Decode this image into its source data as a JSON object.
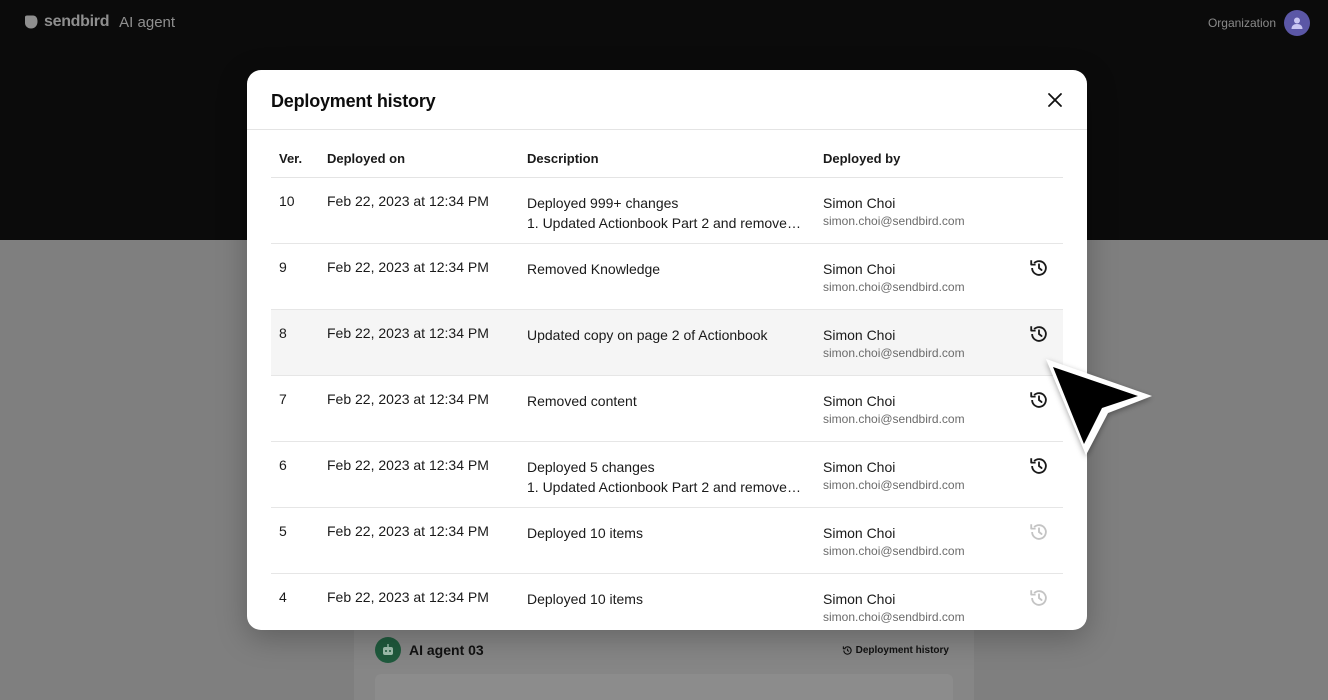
{
  "app": {
    "brand_name": "sendbird",
    "brand_product": "AI agent",
    "org_label": "Organization"
  },
  "background": {
    "agent_name": "AI agent 03",
    "deployment_history_link": "Deployment history"
  },
  "modal": {
    "title": "Deployment history",
    "columns": {
      "ver": "Ver.",
      "deployed_on": "Deployed on",
      "description": "Description",
      "deployed_by": "Deployed by"
    },
    "rows": [
      {
        "ver": "10",
        "date": "Feb 22, 2023 at 12:34 PM",
        "desc1": "Deployed 999+ changes",
        "desc2": "1. Updated Actionbook Part 2 and removed content",
        "name": "Simon Choi",
        "email": "simon.choi@sendbird.com",
        "restore": "none"
      },
      {
        "ver": "9",
        "date": "Feb 22, 2023 at 12:34 PM",
        "desc1": "Removed Knowledge",
        "desc2": "",
        "name": "Simon Choi",
        "email": "simon.choi@sendbird.com",
        "restore": "active"
      },
      {
        "ver": "8",
        "date": "Feb 22, 2023 at 12:34 PM",
        "desc1": "Updated copy on page 2 of Actionbook",
        "desc2": "",
        "name": "Simon Choi",
        "email": "simon.choi@sendbird.com",
        "restore": "active"
      },
      {
        "ver": "7",
        "date": "Feb 22, 2023 at 12:34 PM",
        "desc1": "Removed content",
        "desc2": "",
        "name": "Simon Choi",
        "email": "simon.choi@sendbird.com",
        "restore": "active"
      },
      {
        "ver": "6",
        "date": "Feb 22, 2023 at 12:34 PM",
        "desc1": "Deployed 5 changes",
        "desc2": "1. Updated Actionbook Part 2 and removed content",
        "name": "Simon Choi",
        "email": "simon.choi@sendbird.com",
        "restore": "active"
      },
      {
        "ver": "5",
        "date": "Feb 22, 2023 at 12:34 PM",
        "desc1": "Deployed 10 items",
        "desc2": "",
        "name": "Simon Choi",
        "email": "simon.choi@sendbird.com",
        "restore": "disabled"
      },
      {
        "ver": "4",
        "date": "Feb 22, 2023 at 12:34 PM",
        "desc1": "Deployed 10 items",
        "desc2": "",
        "name": "Simon Choi",
        "email": "simon.choi@sendbird.com",
        "restore": "disabled"
      }
    ],
    "highlighted_row": "8"
  },
  "colors": {
    "icon_active": "#1a1a1a",
    "icon_disabled": "#c4c4c4"
  }
}
